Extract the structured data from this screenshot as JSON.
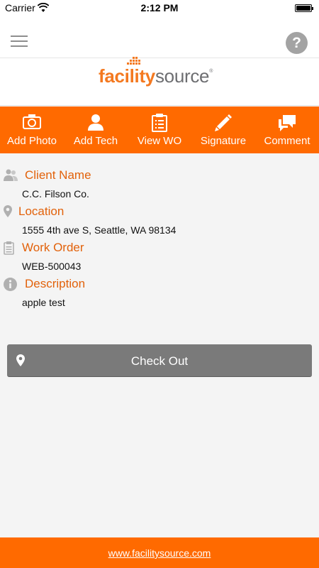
{
  "status_bar": {
    "carrier": "Carrier",
    "time": "2:12 PM"
  },
  "header": {
    "help_label": "?",
    "logo": {
      "part1": "facility",
      "part2": "source",
      "mark": "®",
      "color": "#f47920"
    }
  },
  "toolbar": {
    "background": "#ff6a00",
    "items": [
      {
        "label": "Add Photo",
        "icon": "camera-icon"
      },
      {
        "label": "Add Tech",
        "icon": "person-icon"
      },
      {
        "label": "View WO",
        "icon": "clipboard-icon"
      },
      {
        "label": "Signature",
        "icon": "pencil-icon"
      },
      {
        "label": "Comment",
        "icon": "speech-bubbles-icon"
      }
    ]
  },
  "details": {
    "client": {
      "title": "Client Name",
      "value": "C.C. Filson Co.",
      "icon": "people-icon"
    },
    "location": {
      "title": "Location",
      "value": "1555 4th ave S, Seattle, WA 98134",
      "icon": "map-pin-icon"
    },
    "work_order": {
      "title": "Work Order",
      "value": "WEB-500043",
      "icon": "clipboard-icon"
    },
    "description": {
      "title": "Description",
      "value": "apple test",
      "icon": "info-icon"
    }
  },
  "checkout": {
    "label": "Check Out",
    "icon": "map-pin-icon"
  },
  "footer": {
    "link": "www.facilitysource.com"
  }
}
